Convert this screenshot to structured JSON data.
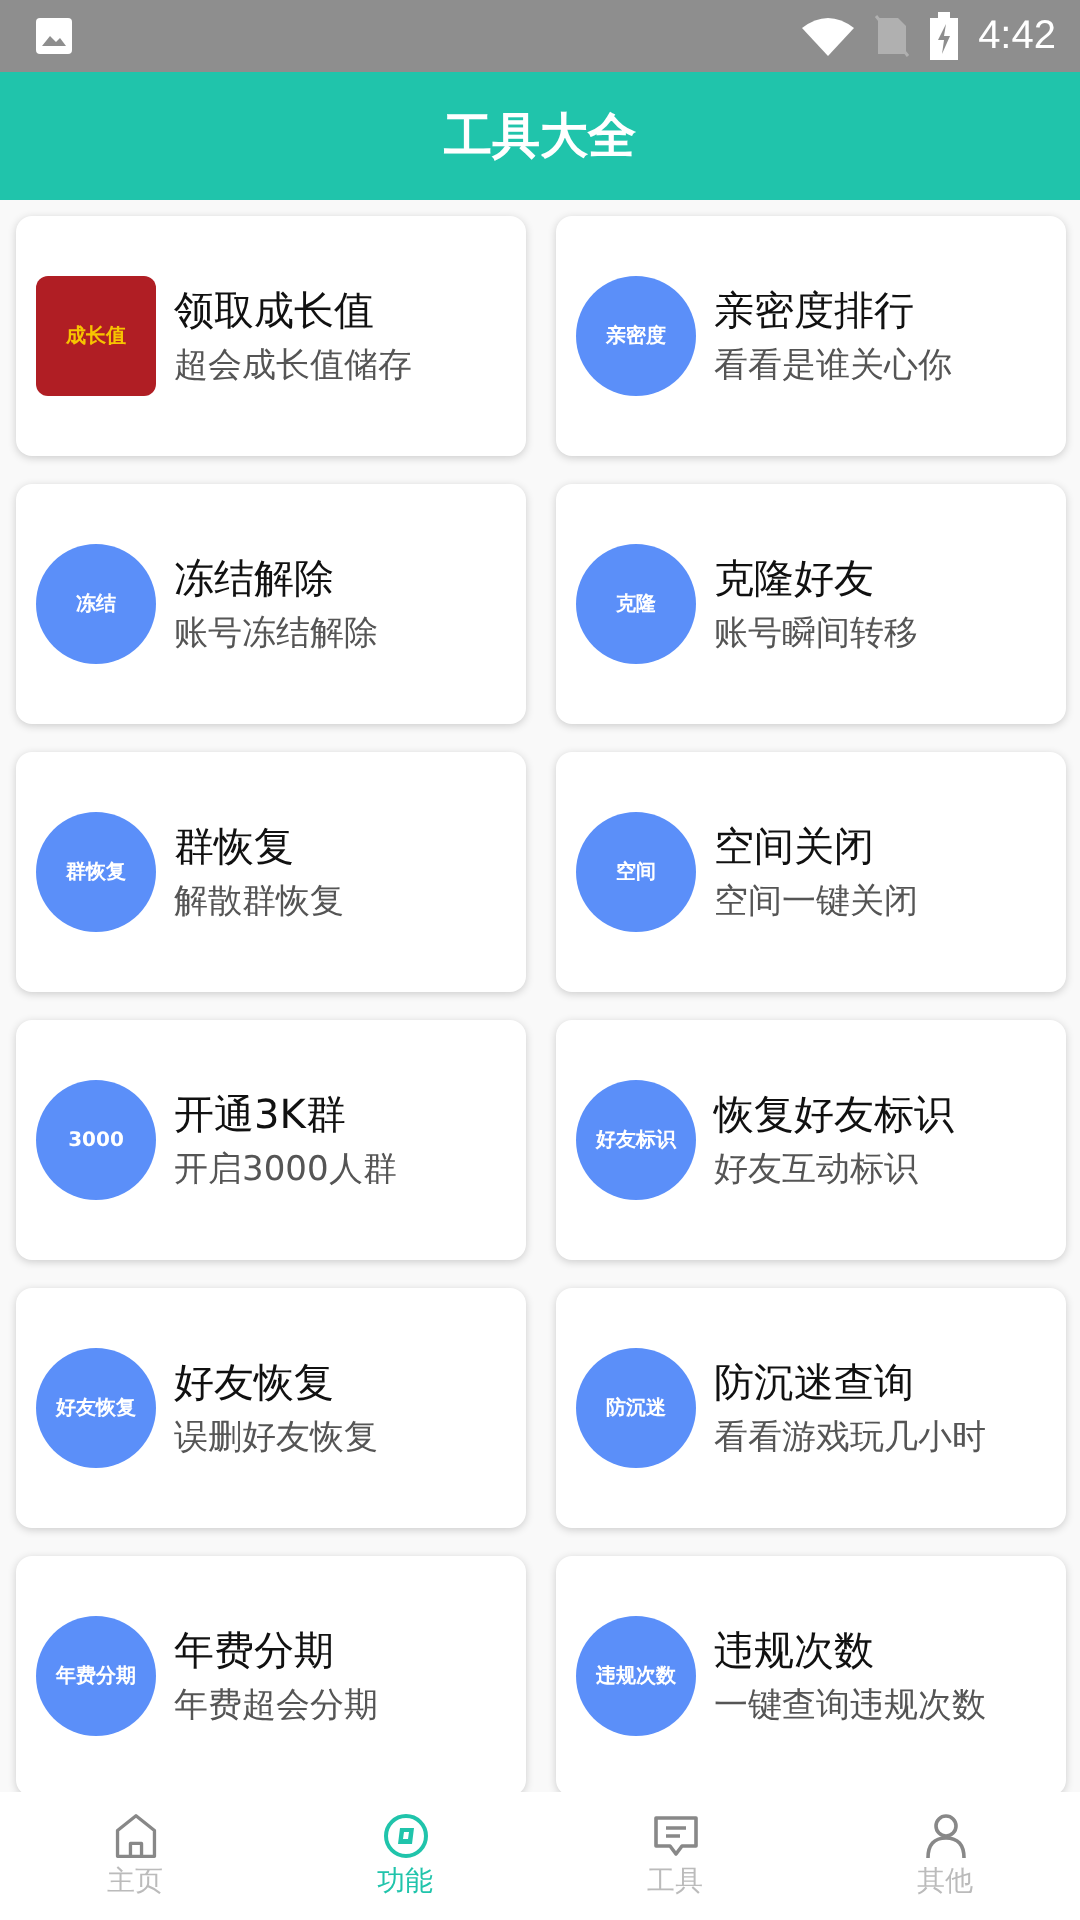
{
  "status_bar": {
    "time": "4:42"
  },
  "header": {
    "title": "工具大全"
  },
  "tools": [
    {
      "badge": "成长值",
      "kind": "square",
      "title": "领取成长值",
      "subtitle": "超会成长值储存"
    },
    {
      "badge": "亲密度",
      "kind": "circle",
      "title": "亲密度排行",
      "subtitle": "看看是谁关心你"
    },
    {
      "badge": "冻结",
      "kind": "circle",
      "title": "冻结解除",
      "subtitle": "账号冻结解除"
    },
    {
      "badge": "克隆",
      "kind": "circle",
      "title": "克隆好友",
      "subtitle": "账号瞬间转移"
    },
    {
      "badge": "群恢复",
      "kind": "circle",
      "title": "群恢复",
      "subtitle": "解散群恢复"
    },
    {
      "badge": "空间",
      "kind": "circle",
      "title": "空间关闭",
      "subtitle": "空间一键关闭"
    },
    {
      "badge": "3000",
      "kind": "circle",
      "title": "开通3K群",
      "subtitle": "开启3000人群"
    },
    {
      "badge": "好友标识",
      "kind": "circle",
      "title": "恢复好友标识",
      "subtitle": "好友互动标识"
    },
    {
      "badge": "好友恢复",
      "kind": "circle",
      "title": "好友恢复",
      "subtitle": "误删好友恢复"
    },
    {
      "badge": "防沉迷",
      "kind": "circle",
      "title": "防沉迷查询",
      "subtitle": "看看游戏玩几小时"
    },
    {
      "badge": "年费分期",
      "kind": "circle",
      "title": "年费分期",
      "subtitle": "年费超会分期"
    },
    {
      "badge": "违规次数",
      "kind": "circle",
      "title": "违规次数",
      "subtitle": "一键查询违规次数"
    }
  ],
  "bottom_nav": [
    {
      "label": "主页",
      "selected": false
    },
    {
      "label": "功能",
      "selected": true
    },
    {
      "label": "工具",
      "selected": false
    },
    {
      "label": "其他",
      "selected": false
    }
  ]
}
